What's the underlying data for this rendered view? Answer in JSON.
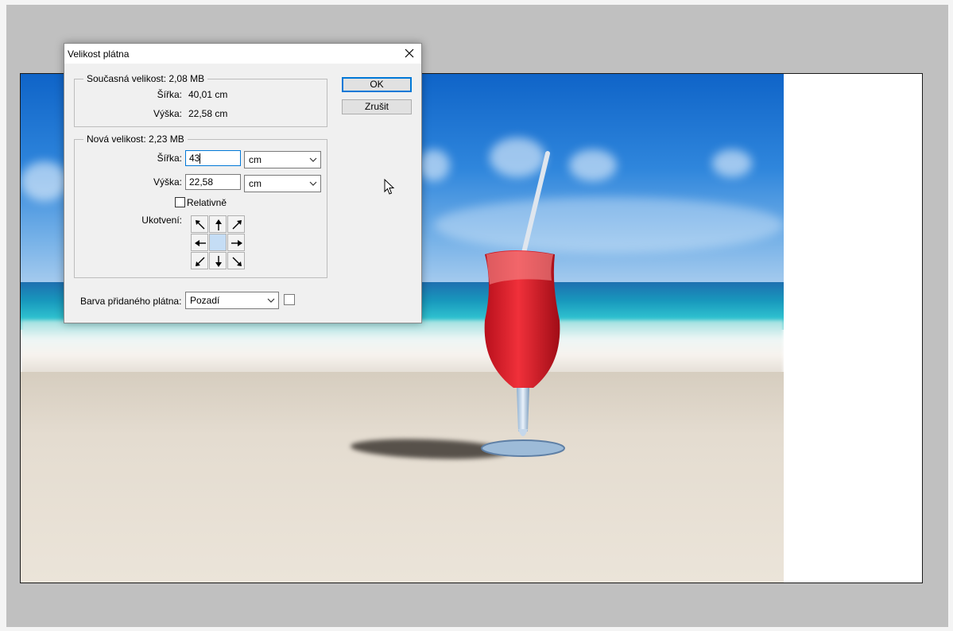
{
  "dialog": {
    "title": "Velikost plátna",
    "current": {
      "legend": "Současná velikost: 2,08 MB",
      "width_label": "Šířka:",
      "width_value": "40,01 cm",
      "height_label": "Výška:",
      "height_value": "22,58 cm"
    },
    "new": {
      "legend": "Nová velikost: 2,23 MB",
      "width_label": "Šířka:",
      "width_value": "43",
      "width_unit": "cm",
      "height_label": "Výška:",
      "height_value": "22,58",
      "height_unit": "cm",
      "relative_label": "Relativně",
      "relative_checked": false,
      "anchor_label": "Ukotvení:",
      "anchor_selected": "center"
    },
    "canvas_color_label": "Barva přidaného plátna:",
    "canvas_color_value": "Pozadí",
    "ok_label": "OK",
    "cancel_label": "Zrušit"
  },
  "colors": {
    "accent": "#0078d7",
    "dialog_bg": "#f0f0f0",
    "workspace_bg": "#c0c0c0",
    "anchor_center": "#c5ddf5"
  },
  "icons": [
    "close-icon",
    "chevron-down-icon",
    "arrow-icon",
    "cursor-icon"
  ]
}
